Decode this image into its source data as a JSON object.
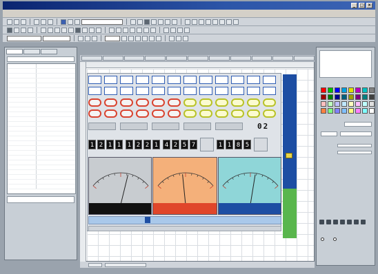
{
  "window": {
    "title": ""
  },
  "menubar": {
    "items": [
      "",
      "",
      "",
      "",
      "",
      "",
      "",
      "",
      ""
    ]
  },
  "left_panel": {
    "tabs": [
      "",
      "",
      ""
    ],
    "rows": [
      {
        "k": "",
        "v": ""
      },
      {
        "k": "",
        "v": ""
      },
      {
        "k": "",
        "v": ""
      },
      {
        "k": "",
        "v": ""
      },
      {
        "k": "",
        "v": ""
      }
    ]
  },
  "canvas": {
    "blue_row_1": [
      "",
      "",
      "",
      "",
      "",
      "",
      "",
      "",
      "",
      "",
      "",
      "",
      ""
    ],
    "blue_row_2": [
      "",
      "",
      "",
      "",
      "",
      "",
      "",
      "",
      "",
      "",
      "",
      "",
      ""
    ],
    "oval_red": [
      "",
      "",
      "",
      "",
      "",
      "",
      ""
    ],
    "oval_yellow": [
      "",
      "",
      "",
      "",
      "",
      ""
    ],
    "gray_buttons": [
      "",
      "",
      "",
      "",
      ""
    ],
    "display_value": "02",
    "digit_groups": [
      {
        "digits": [
          "1",
          "2",
          "1",
          "1"
        ]
      },
      {
        "digits": [
          "1",
          "2",
          "2",
          "1"
        ]
      },
      {
        "digits": [
          "4",
          "2",
          "5",
          "7"
        ]
      },
      {
        "digits": [
          "1",
          "1",
          "8",
          "5"
        ]
      }
    ],
    "meters": [
      {
        "face_color": "#c8ccd0",
        "bar_color": "#111111",
        "needle_value": 0.62
      },
      {
        "face_color": "#f4b07a",
        "bar_color": "#e0462a",
        "needle_value": 0.45
      },
      {
        "face_color": "#8fd6d8",
        "bar_color": "#1d4ea3",
        "needle_value": 0.58
      }
    ],
    "slider_value": 0.3
  },
  "right_panel": {
    "palette_colors": [
      "#ff0000",
      "#00c000",
      "#0000ff",
      "#00a0e0",
      "#e0e000",
      "#c000c0",
      "#00c0c0",
      "#808080",
      "#a00000",
      "#008000",
      "#000090",
      "#006080",
      "#a0a000",
      "#800080",
      "#008080",
      "#404040",
      "#ffc0c0",
      "#c0ffc0",
      "#c0c0ff",
      "#c0e8ff",
      "#ffffc0",
      "#ffc0ff",
      "#c0ffff",
      "#e0e0e0",
      "#ff8040",
      "#80ff80",
      "#8080ff",
      "#80c0ff",
      "#ffff80",
      "#ff80ff",
      "#80ffff",
      "#ffffff"
    ],
    "radio_labels": [
      "",
      ""
    ]
  },
  "status": {
    "cells": [
      "",
      ""
    ]
  }
}
